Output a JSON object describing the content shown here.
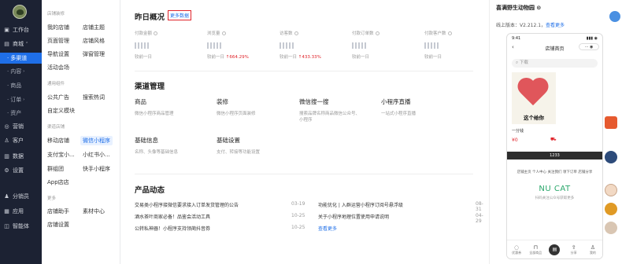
{
  "sidebar": {
    "items": [
      {
        "label": "工作台",
        "icon": "▣"
      },
      {
        "label": "商城",
        "icon": "▤"
      },
      {
        "label": "多渠道"
      },
      {
        "label": "内容"
      },
      {
        "label": "商品"
      },
      {
        "label": "订单"
      },
      {
        "label": "资产"
      },
      {
        "label": "营销",
        "icon": "◎"
      },
      {
        "label": "客户",
        "icon": "♙"
      },
      {
        "label": "数据",
        "icon": "▥"
      },
      {
        "label": "设置",
        "icon": "⚙"
      },
      {
        "label": "分销员",
        "icon": "♟"
      },
      {
        "label": "应用",
        "icon": "▦"
      },
      {
        "label": "智能体",
        "icon": "◫"
      }
    ]
  },
  "subnav": {
    "group1": "店铺装修",
    "g1_items": [
      "我的店铺",
      "店铺主题",
      "页面管理",
      "店铺风格",
      "导航设置",
      "弹窗管理",
      "活动会场"
    ],
    "group2": "通用组件",
    "g2_items": [
      "公共广告",
      "搜索热词",
      "自定义模块"
    ],
    "group3": "渠道店铺",
    "g3_items": [
      "移动店铺",
      "微信小程序",
      "支付宝小...",
      "小红书小...",
      "群组团",
      "快手小程序",
      "App店店"
    ],
    "group4": "更多",
    "g4_items": [
      "店铺助手",
      "素材中心",
      "店铺设置"
    ]
  },
  "overview": {
    "title": "昨日概况",
    "more_button": "更多数据",
    "stats": [
      {
        "label": "付款金额",
        "compare": "较前一日"
      },
      {
        "label": "浏览量",
        "compare": "较前一日",
        "change": "664.29%"
      },
      {
        "label": "访客数",
        "compare": "较前一日",
        "change": "433.33%"
      },
      {
        "label": "付款订单数",
        "compare": "较前一日"
      },
      {
        "label": "付款客户数",
        "compare": "较前一日"
      }
    ]
  },
  "channel": {
    "title": "渠道管理",
    "cards": [
      {
        "title": "商品",
        "desc": "微信小程序商品管理"
      },
      {
        "title": "装修",
        "desc": "微信小程序页面装修"
      },
      {
        "title": "微信搜一搜",
        "desc": "搜索品牌名称商品微信公众号、小程序"
      },
      {
        "title": "小程序直播",
        "desc": "一站式小程序直播"
      },
      {
        "title": "基础信息",
        "desc": "名称、头像等基础信息"
      },
      {
        "title": "基础设置",
        "desc": "支付、转接等功能设置"
      }
    ]
  },
  "news": {
    "title": "产品动态",
    "items": [
      {
        "text": "交易类小程序接微信要求接入订单发货管理的公告",
        "date": "03-19"
      },
      {
        "text": "功能优化 | 入群运营小程序订阅号悬浮级",
        "date": "08-31"
      },
      {
        "text": "酒水茶叶商家必备！品鉴会活动工具",
        "date": "10-25"
      },
      {
        "text": "关于小程序地理位置使用申请说明",
        "date": "04-29"
      },
      {
        "text": "公转私神器！小程序支持领蔺抖音券",
        "date": "10-25"
      },
      {
        "text": "查看更多",
        "date": ""
      }
    ]
  },
  "preview": {
    "shop_name": "喜满野生动物园 ⊙",
    "version_label": "线上版本：V2.212.1，",
    "version_link": "查看更多",
    "status_time": "9:41",
    "status_icons": "▮▮▮ ◉",
    "page_title": "店铺首页",
    "search_placeholder": "⌕ 下载",
    "product_text": "这个给你",
    "price_label": "一分钱",
    "price": "¥0",
    "banner_text": "1233",
    "tabs": "店铺主页  个人中心  关注我们  领下订单  店铺分享",
    "brand": "NU CAT",
    "brand_sub": "扫码关注公众号获取更多",
    "bottom_tabs": [
      "优惠券",
      "全部商品",
      "",
      "分享",
      "我的"
    ]
  }
}
